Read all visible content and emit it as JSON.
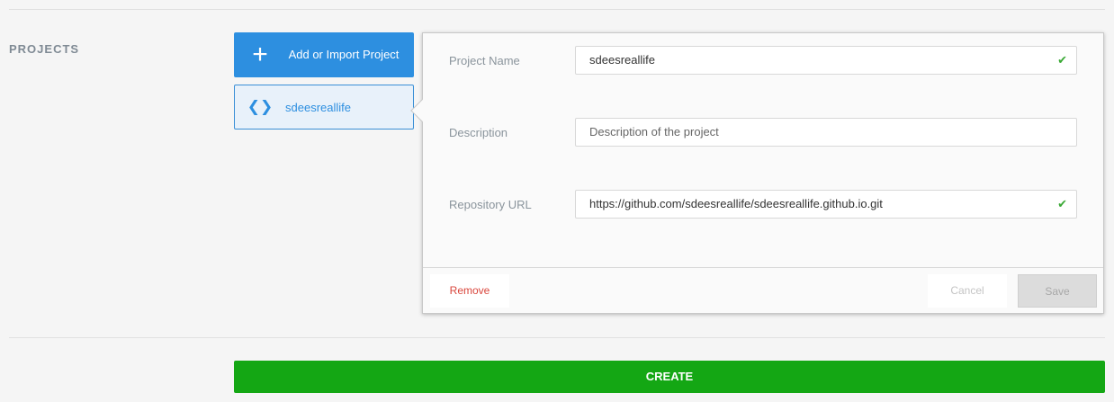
{
  "section": {
    "label": "PROJECTS"
  },
  "add_button": {
    "icon": "plus-icon",
    "label": "Add or Import Project"
  },
  "project_item": {
    "icon": "code-icon",
    "label": "sdeesreallife"
  },
  "form": {
    "project_name": {
      "label": "Project Name",
      "value": "sdeesreallife",
      "valid": true
    },
    "description": {
      "label": "Description",
      "placeholder": "Description of the project",
      "value": ""
    },
    "repository_url": {
      "label": "Repository URL",
      "value": "https://github.com/sdeesreallife/sdeesreallife.github.io.git",
      "valid": true
    }
  },
  "footer": {
    "remove_label": "Remove",
    "cancel_label": "Cancel",
    "save_label": "Save"
  },
  "create": {
    "label": "CREATE"
  },
  "colors": {
    "accent": "#2d8fe0",
    "success": "#14a714",
    "danger": "#d9463c",
    "check": "#3aa935"
  }
}
